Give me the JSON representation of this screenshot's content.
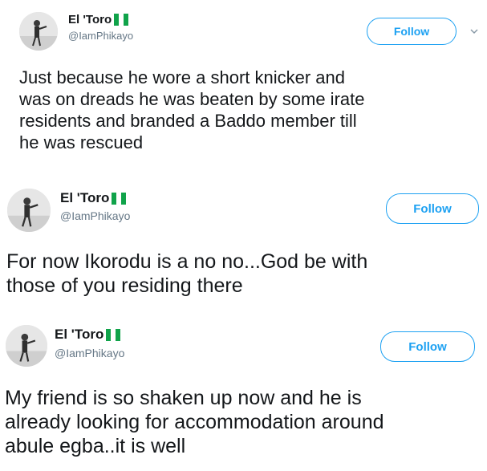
{
  "colors": {
    "accent": "#1da1f2",
    "handle": "#657786",
    "text": "#14171a",
    "flag_green": "#10a34a"
  },
  "tweets": [
    {
      "display_name": "El 'Toro",
      "handle": "@IamPhikayo",
      "follow_label": "Follow",
      "flag_icon": "nigeria-flag-emoji",
      "has_caret": true,
      "text": "Just because he wore a short knicker and\nwas on dreads he was beaten by some irate\nresidents and branded a Baddo member till\nhe was rescued"
    },
    {
      "display_name": "El 'Toro",
      "handle": "@IamPhikayo",
      "follow_label": "Follow",
      "flag_icon": "nigeria-flag-emoji",
      "has_caret": false,
      "text": "For now Ikorodu is a no no...God be with\nthose of you residing there"
    },
    {
      "display_name": "El 'Toro",
      "handle": "@IamPhikayo",
      "follow_label": "Follow",
      "flag_icon": "nigeria-flag-emoji",
      "has_caret": false,
      "text": "My friend is so shaken up now and he is\nalready looking for accommodation around\nabule egba..it is well"
    }
  ]
}
